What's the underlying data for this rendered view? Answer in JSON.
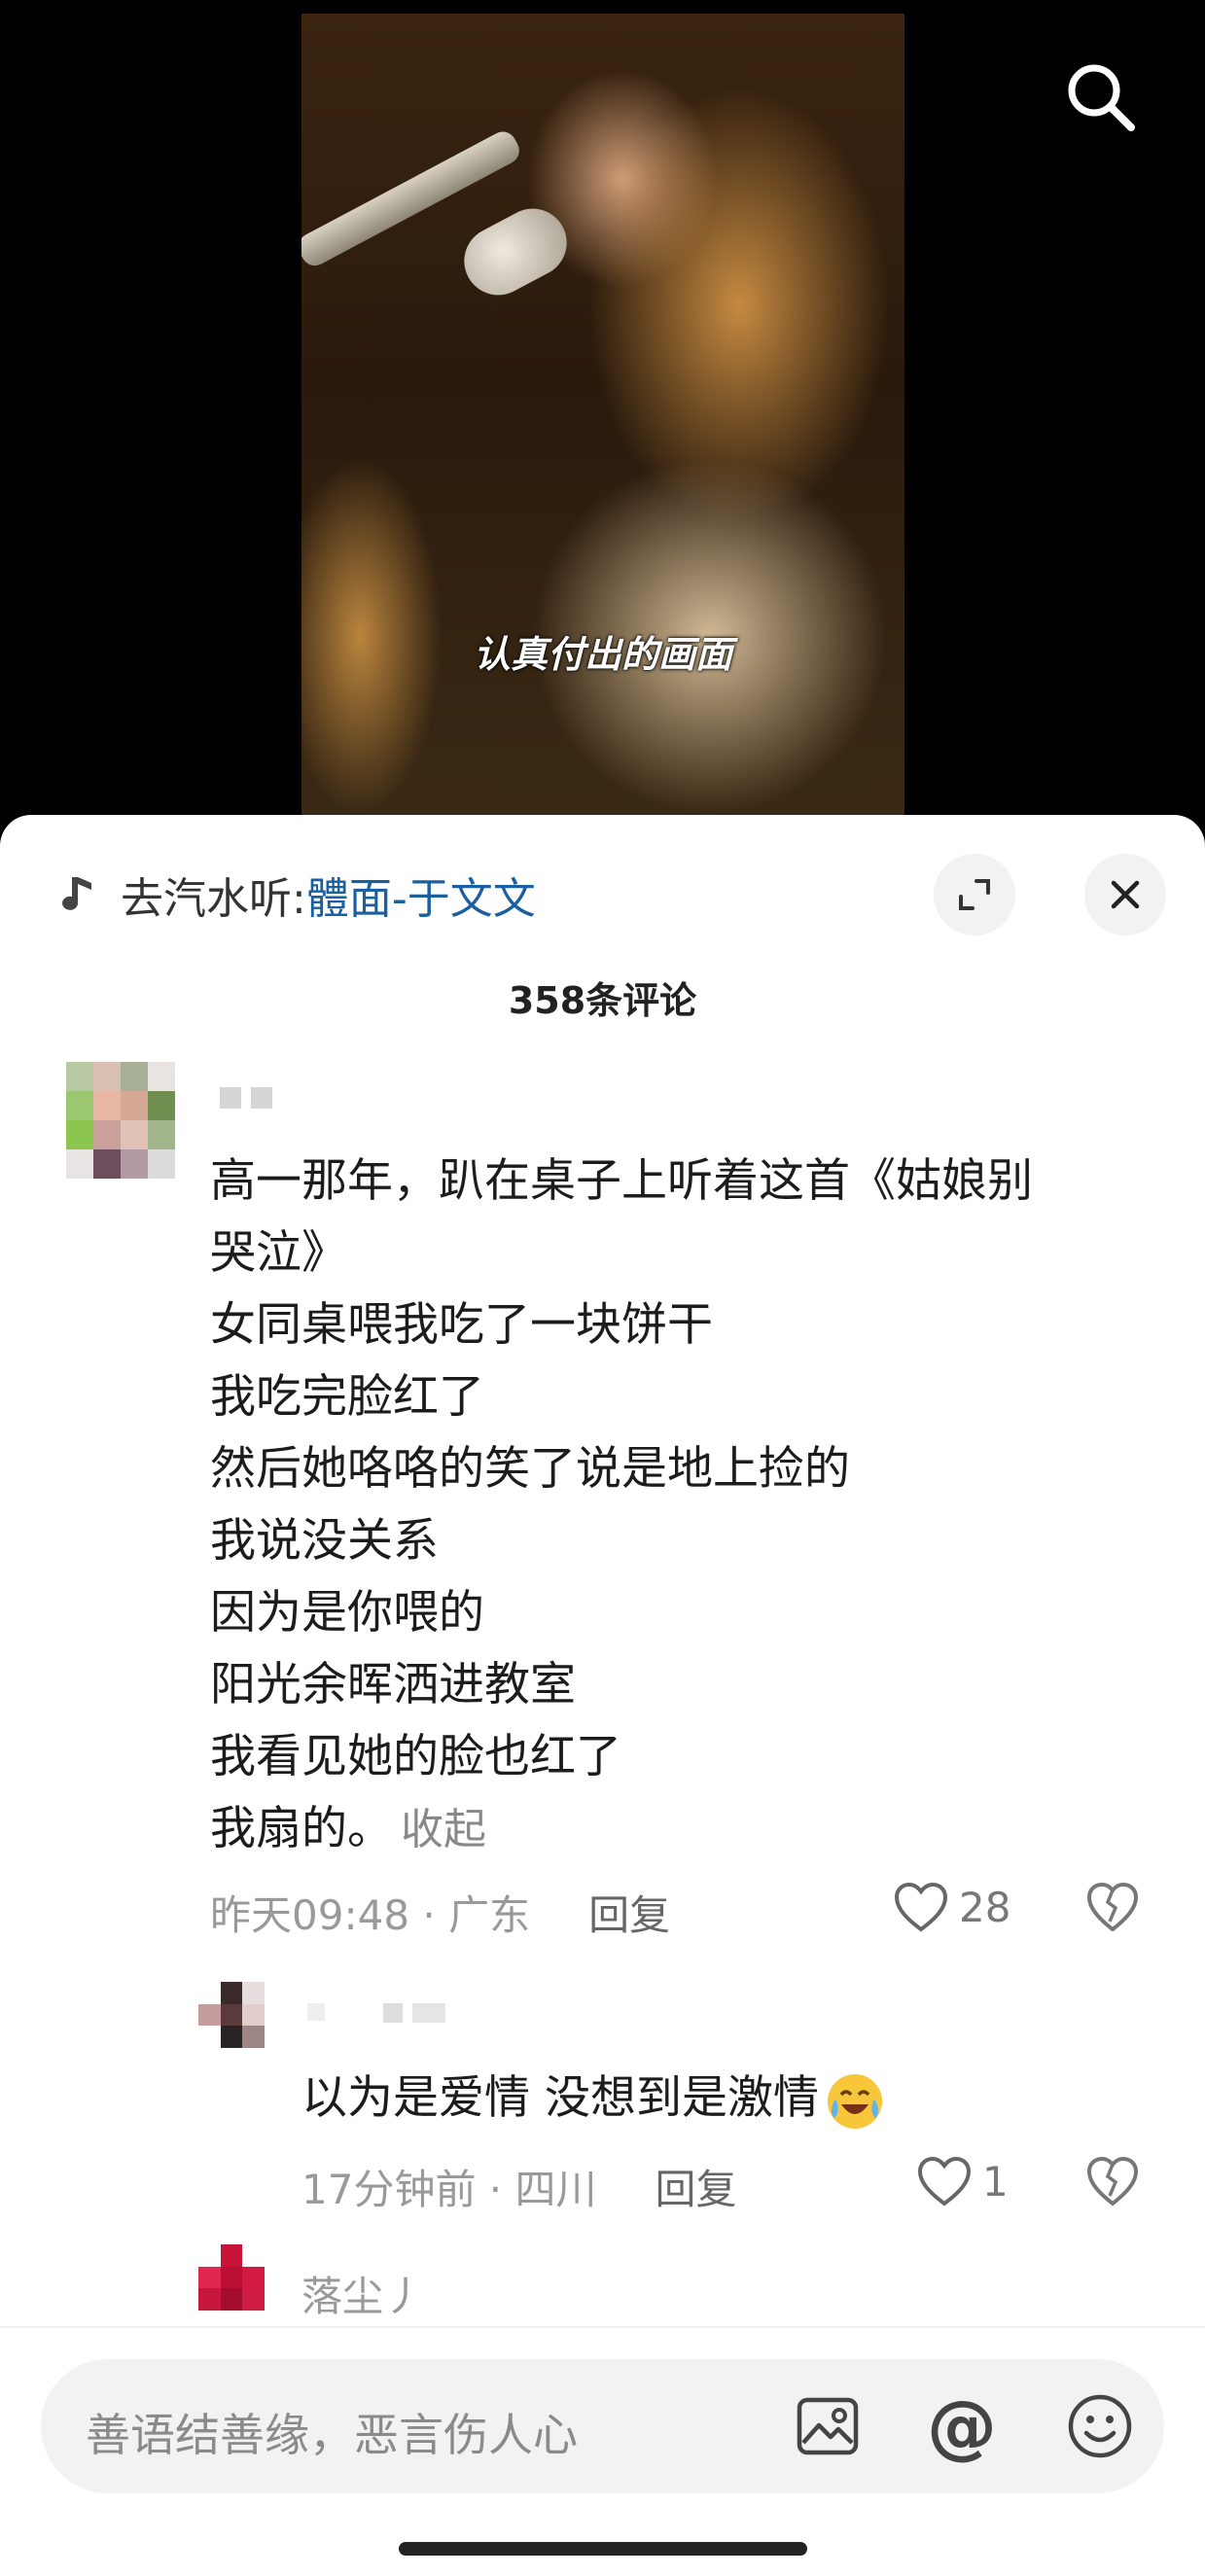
{
  "video": {
    "subtitle": "认真付出的画面"
  },
  "icons": {
    "search": "search-icon",
    "music_note": "music-note-icon",
    "expand": "expand-icon",
    "close": "close-icon",
    "heart": "heart-icon",
    "dislike": "broken-heart-icon",
    "image": "image-icon",
    "at": "at-icon",
    "emoji": "smiley-icon"
  },
  "music_bar": {
    "prefix": "去汽水听: ",
    "song": "體面-于文文"
  },
  "comments_header": {
    "title": "358条评论"
  },
  "comments": [
    {
      "text": "高一那年，趴在桌子上听着这首《姑娘别\n哭泣》\n女同桌喂我吃了一块饼干\n我吃完脸红了\n然后她咯咯的笑了说是地上捡的\n我说没关系\n因为是你喂的\n阳光余晖洒进教室\n我看见她的脸也红了\n我扇的。",
      "collapse_label": "收起",
      "time": "昨天09:48 · 广东",
      "reply_label": "回复",
      "likes": "28"
    }
  ],
  "replies": [
    {
      "text": "以为是爱情 没想到是激情",
      "time": "17分钟前 · 四川",
      "reply_label": "回复",
      "likes": "1"
    },
    {
      "author": "落尘丿"
    }
  ],
  "input": {
    "placeholder": "善语结善缘，恶言伤人心",
    "at_symbol": "@"
  },
  "colors": {
    "link": "#1a5fa0",
    "sheet_bg": "#ffffff",
    "video_bg": "#000000"
  }
}
